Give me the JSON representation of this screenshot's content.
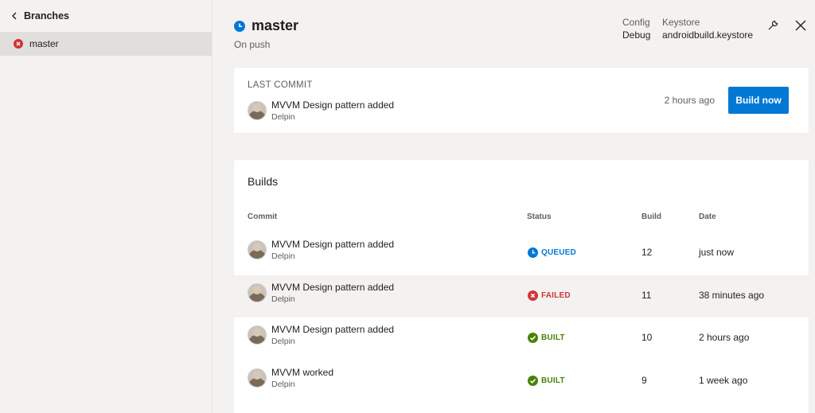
{
  "colors": {
    "accent": "#0078d4",
    "failed": "#d13438",
    "built": "#498205",
    "queued": "#0078d4"
  },
  "sidebar": {
    "back_label": "Branches",
    "items": [
      {
        "label": "master",
        "status_icon": "error-icon"
      }
    ]
  },
  "header": {
    "title": "master",
    "subtitle": "On push",
    "config_label": "Config",
    "config_value": "Debug",
    "keystore_label": "Keystore",
    "keystore_value": "androidbuild.keystore"
  },
  "last_commit": {
    "label": "LAST COMMIT",
    "message": "MVVM Design pattern added",
    "author": "Delpin",
    "time": "2 hours ago",
    "button_label": "Build now"
  },
  "builds": {
    "title": "Builds",
    "columns": {
      "commit": "Commit",
      "status": "Status",
      "build": "Build",
      "date": "Date"
    },
    "rows": [
      {
        "message": "MVVM Design pattern added",
        "author": "Delpin",
        "status": "QUEUED",
        "status_icon": "clock-icon",
        "build": "12",
        "date": "just now"
      },
      {
        "message": "MVVM Design pattern added",
        "author": "Delpin",
        "status": "FAILED",
        "status_icon": "error-icon",
        "build": "11",
        "date": "38 minutes ago"
      },
      {
        "message": "MVVM Design pattern added",
        "author": "Delpin",
        "status": "BUILT",
        "status_icon": "check-icon",
        "build": "10",
        "date": "2 hours ago"
      },
      {
        "message": "MVVM worked",
        "author": "Delpin",
        "status": "BUILT",
        "status_icon": "check-icon",
        "build": "9",
        "date": "1 week ago"
      }
    ]
  }
}
